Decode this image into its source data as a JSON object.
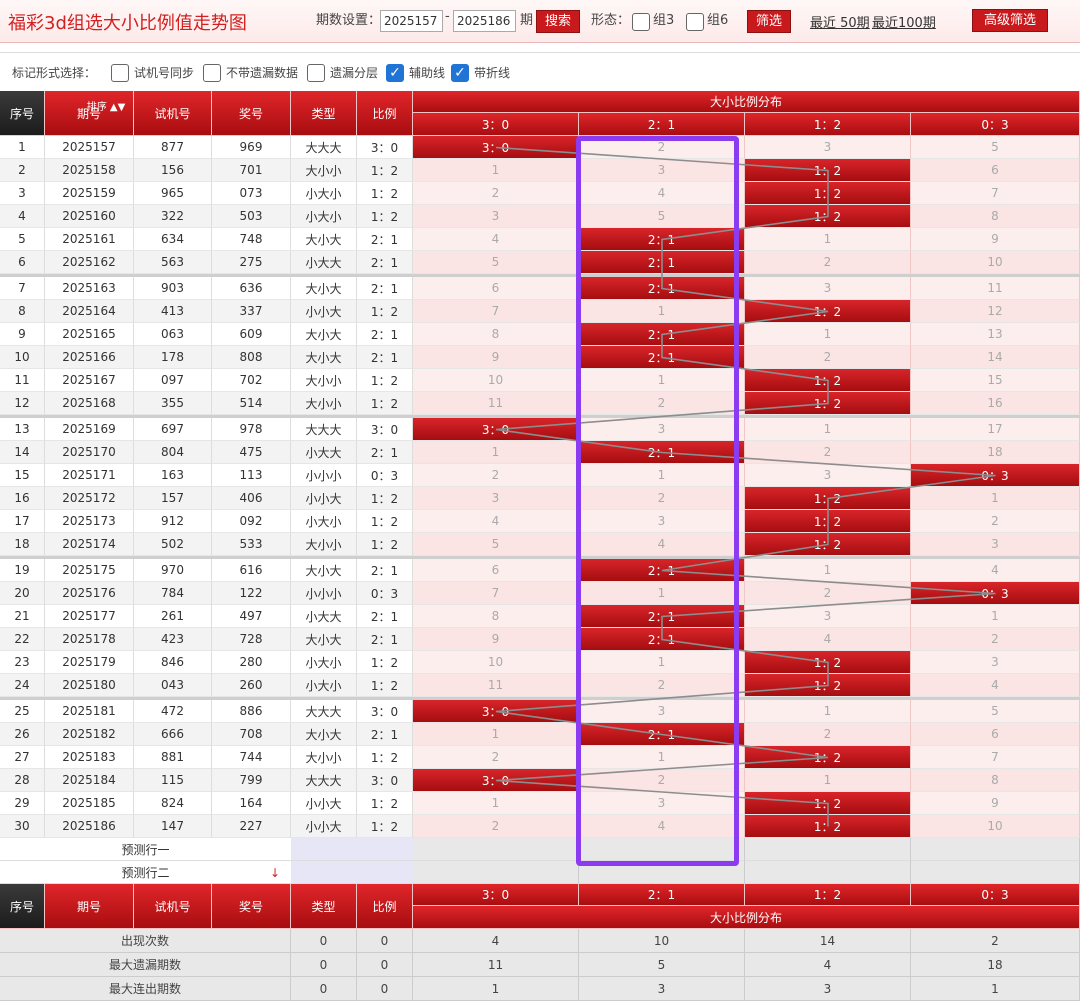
{
  "title": "福彩3d组选大小比例值走势图",
  "toolbar": {
    "period_label": "期数设置：",
    "from": "2025157",
    "dash": "-",
    "to": "2025186",
    "period_suffix": "期",
    "search": "搜索",
    "shape_label": "形态：",
    "g3": "组3",
    "g6": "组6",
    "filter": "筛选",
    "recent50": "最近 50期",
    "recent100": "最近100期",
    "advanced": "高级筛选"
  },
  "marks": {
    "label": "标记形式选择：",
    "opts": [
      {
        "text": "试机号同步",
        "checked": false
      },
      {
        "text": "不带遗漏数据",
        "checked": false
      },
      {
        "text": "遗漏分层",
        "checked": false
      },
      {
        "text": "辅助线",
        "checked": true
      },
      {
        "text": "带折线",
        "checked": true
      }
    ]
  },
  "header": {
    "seq": "序号",
    "period": "期号",
    "sort": "排序",
    "test": "试机号",
    "draw": "奖号",
    "type": "类型",
    "ratio": "比例",
    "dist": "大小比例分布",
    "cols": [
      "3：0",
      "2：1",
      "1：2",
      "0：3"
    ]
  },
  "rows": [
    [
      "1",
      "2025157",
      "877",
      "969",
      "大大大",
      "3：0",
      0,
      [
        0,
        2,
        3,
        5
      ]
    ],
    [
      "2",
      "2025158",
      "156",
      "701",
      "大小小",
      "1：2",
      2,
      [
        1,
        3,
        0,
        6
      ]
    ],
    [
      "3",
      "2025159",
      "965",
      "073",
      "小大小",
      "1：2",
      2,
      [
        2,
        4,
        0,
        7
      ]
    ],
    [
      "4",
      "2025160",
      "322",
      "503",
      "小大小",
      "1：2",
      2,
      [
        3,
        5,
        0,
        8
      ]
    ],
    [
      "5",
      "2025161",
      "634",
      "748",
      "大小大",
      "2：1",
      1,
      [
        4,
        0,
        1,
        9
      ]
    ],
    [
      "6",
      "2025162",
      "563",
      "275",
      "小大大",
      "2：1",
      1,
      [
        5,
        0,
        2,
        10
      ]
    ],
    [
      "7",
      "2025163",
      "903",
      "636",
      "大小大",
      "2：1",
      1,
      [
        6,
        0,
        3,
        11
      ]
    ],
    [
      "8",
      "2025164",
      "413",
      "337",
      "小小大",
      "1：2",
      2,
      [
        7,
        1,
        0,
        12
      ]
    ],
    [
      "9",
      "2025165",
      "063",
      "609",
      "大小大",
      "2：1",
      1,
      [
        8,
        0,
        1,
        13
      ]
    ],
    [
      "10",
      "2025166",
      "178",
      "808",
      "大小大",
      "2：1",
      1,
      [
        9,
        0,
        2,
        14
      ]
    ],
    [
      "11",
      "2025167",
      "097",
      "702",
      "大小小",
      "1：2",
      2,
      [
        10,
        1,
        0,
        15
      ]
    ],
    [
      "12",
      "2025168",
      "355",
      "514",
      "大小小",
      "1：2",
      2,
      [
        11,
        2,
        0,
        16
      ]
    ],
    [
      "13",
      "2025169",
      "697",
      "978",
      "大大大",
      "3：0",
      0,
      [
        0,
        3,
        1,
        17
      ]
    ],
    [
      "14",
      "2025170",
      "804",
      "475",
      "小大大",
      "2：1",
      1,
      [
        1,
        0,
        2,
        18
      ]
    ],
    [
      "15",
      "2025171",
      "163",
      "113",
      "小小小",
      "0：3",
      3,
      [
        2,
        1,
        3,
        0
      ]
    ],
    [
      "16",
      "2025172",
      "157",
      "406",
      "小小大",
      "1：2",
      2,
      [
        3,
        2,
        0,
        1
      ]
    ],
    [
      "17",
      "2025173",
      "912",
      "092",
      "小大小",
      "1：2",
      2,
      [
        4,
        3,
        0,
        2
      ]
    ],
    [
      "18",
      "2025174",
      "502",
      "533",
      "大小小",
      "1：2",
      2,
      [
        5,
        4,
        0,
        3
      ]
    ],
    [
      "19",
      "2025175",
      "970",
      "616",
      "大小大",
      "2：1",
      1,
      [
        6,
        0,
        1,
        4
      ]
    ],
    [
      "20",
      "2025176",
      "784",
      "122",
      "小小小",
      "0：3",
      3,
      [
        7,
        1,
        2,
        0
      ]
    ],
    [
      "21",
      "2025177",
      "261",
      "497",
      "小大大",
      "2：1",
      1,
      [
        8,
        0,
        3,
        1
      ]
    ],
    [
      "22",
      "2025178",
      "423",
      "728",
      "大小大",
      "2：1",
      1,
      [
        9,
        0,
        4,
        2
      ]
    ],
    [
      "23",
      "2025179",
      "846",
      "280",
      "小大小",
      "1：2",
      2,
      [
        10,
        1,
        0,
        3
      ]
    ],
    [
      "24",
      "2025180",
      "043",
      "260",
      "小大小",
      "1：2",
      2,
      [
        11,
        2,
        0,
        4
      ]
    ],
    [
      "25",
      "2025181",
      "472",
      "886",
      "大大大",
      "3：0",
      0,
      [
        0,
        3,
        1,
        5
      ]
    ],
    [
      "26",
      "2025182",
      "666",
      "708",
      "大小大",
      "2：1",
      1,
      [
        1,
        0,
        2,
        6
      ]
    ],
    [
      "27",
      "2025183",
      "881",
      "744",
      "大小小",
      "1：2",
      2,
      [
        2,
        1,
        0,
        7
      ]
    ],
    [
      "28",
      "2025184",
      "115",
      "799",
      "大大大",
      "3：0",
      0,
      [
        0,
        2,
        1,
        8
      ]
    ],
    [
      "29",
      "2025185",
      "824",
      "164",
      "小小大",
      "1：2",
      2,
      [
        1,
        3,
        0,
        9
      ]
    ],
    [
      "30",
      "2025186",
      "147",
      "227",
      "小小大",
      "1：2",
      2,
      [
        2,
        4,
        0,
        10
      ]
    ]
  ],
  "predict": [
    "预测行一",
    "预测行二"
  ],
  "stats": [
    {
      "label": "出现次数",
      "t": "0",
      "r": "0",
      "v": [
        "4",
        "10",
        "14",
        "2"
      ]
    },
    {
      "label": "最大遗漏期数",
      "t": "0",
      "r": "0",
      "v": [
        "11",
        "5",
        "4",
        "18"
      ]
    },
    {
      "label": "最大连出期数",
      "t": "0",
      "r": "0",
      "v": [
        "1",
        "3",
        "3",
        "1"
      ]
    }
  ],
  "colors": {
    "accent": "#c8191d",
    "highlight": "#8b3cf0"
  }
}
